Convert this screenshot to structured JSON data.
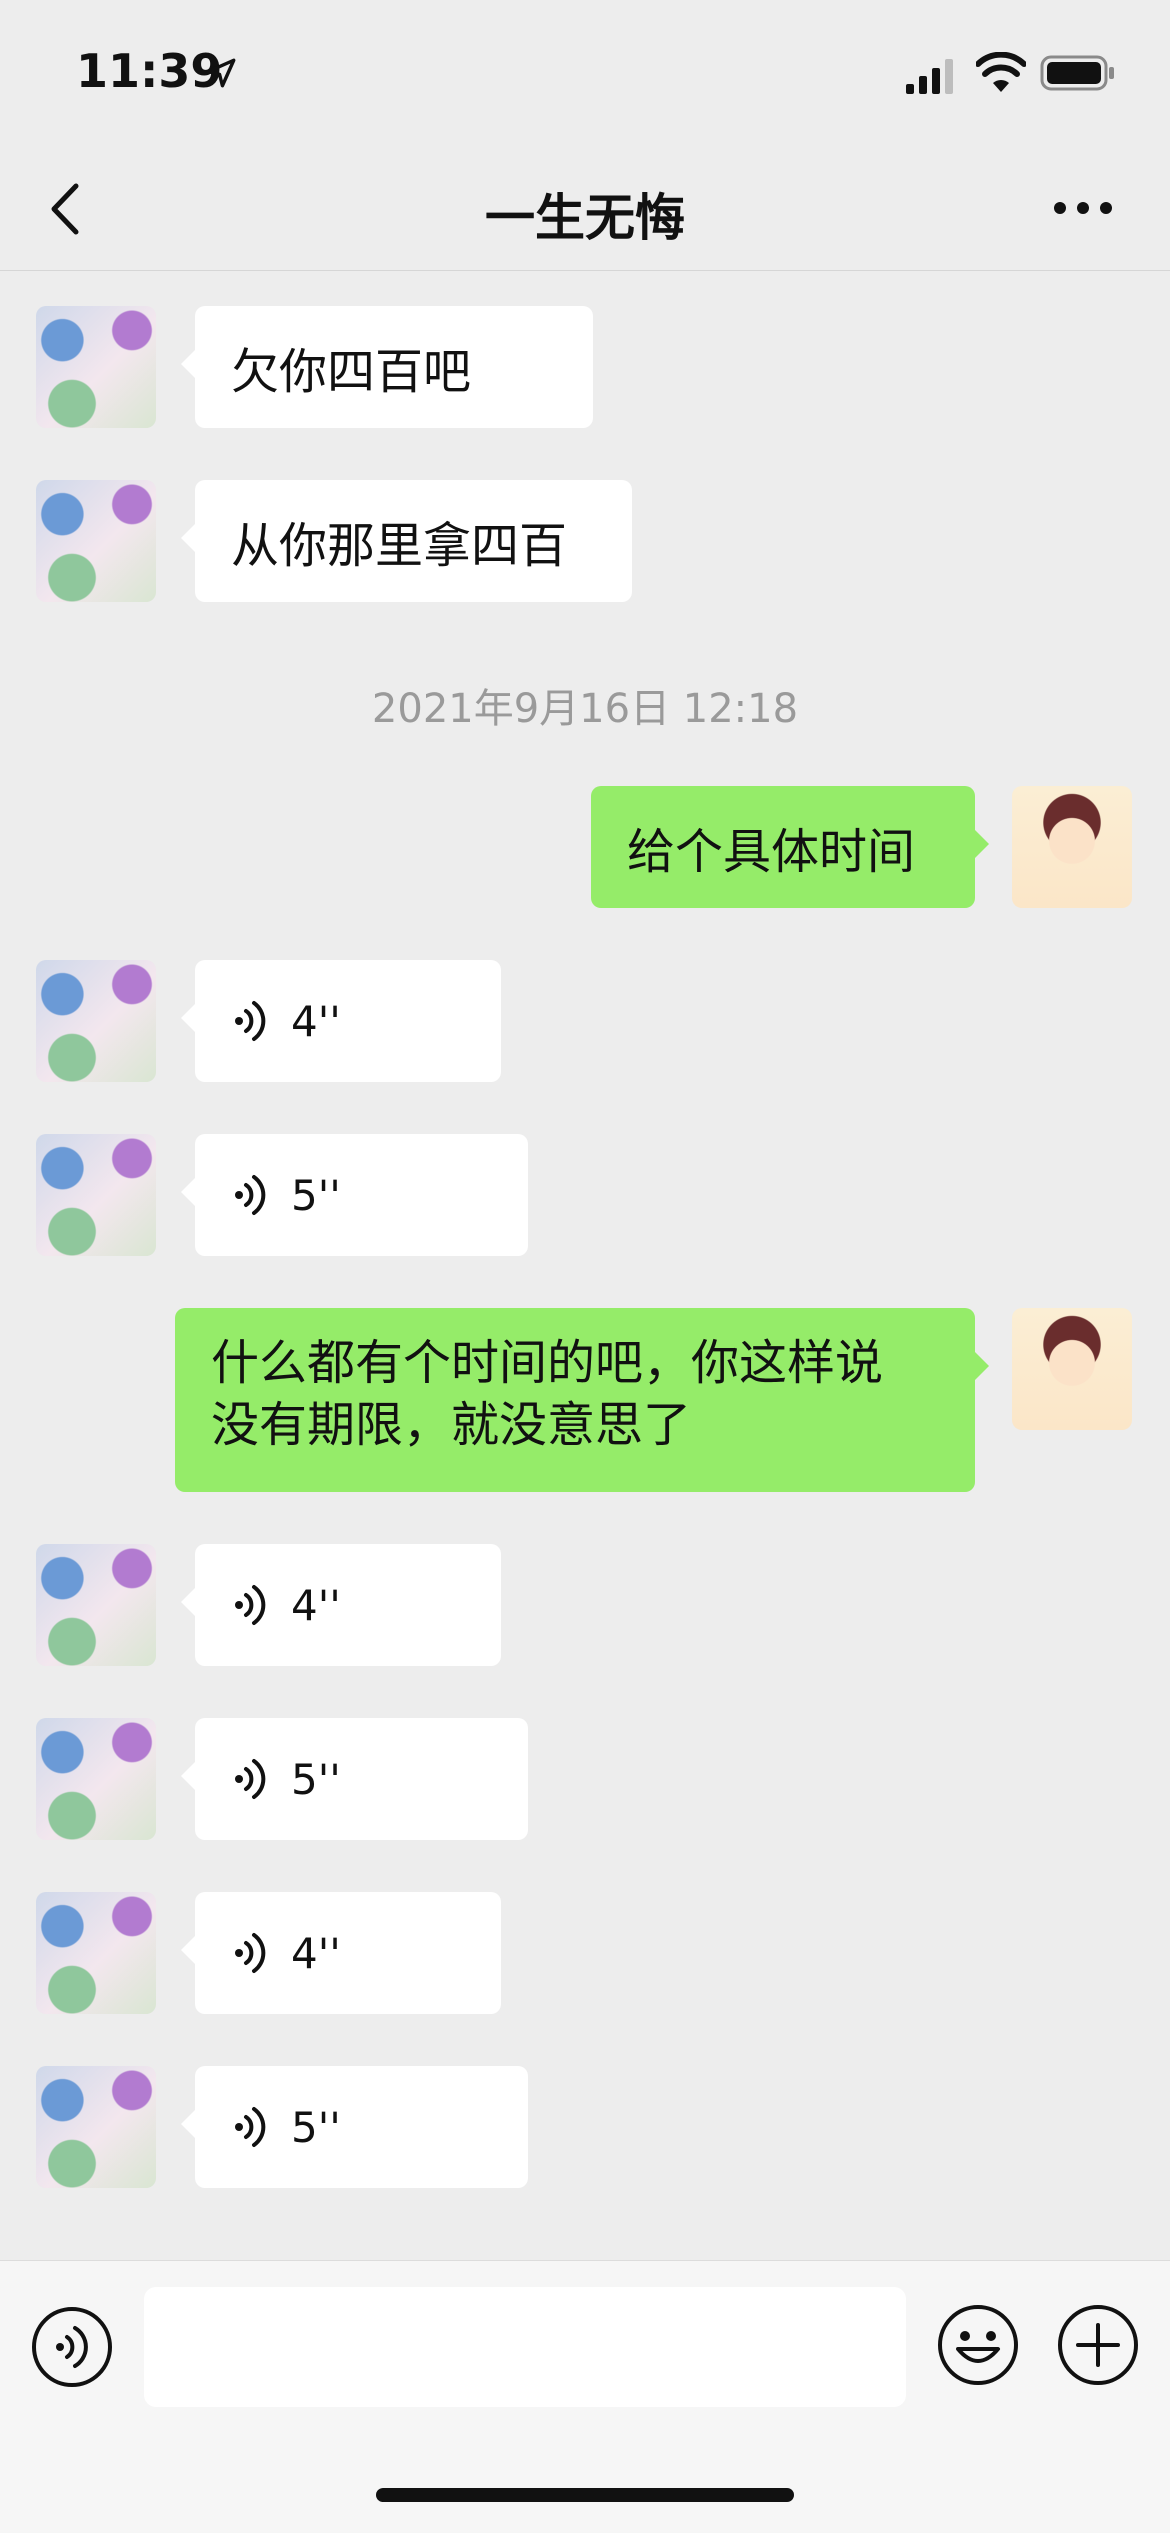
{
  "status": {
    "time": "11:39"
  },
  "nav": {
    "title": "一生无悔"
  },
  "messages": [
    {
      "side": "left",
      "type": "text",
      "text": "欠你四百吧"
    },
    {
      "side": "left",
      "type": "text",
      "text": "从你那里拿四百"
    },
    {
      "type": "timestamp",
      "text": "2021年9月16日 12:18"
    },
    {
      "side": "right",
      "type": "text",
      "text": "给个具体时间"
    },
    {
      "side": "left",
      "type": "voice",
      "duration": "4''"
    },
    {
      "side": "left",
      "type": "voice",
      "duration": "5''"
    },
    {
      "side": "right",
      "type": "text",
      "line1": "什么都有个时间的吧，你这样说",
      "line2": "没有期限，就没意思了"
    },
    {
      "side": "left",
      "type": "voice",
      "duration": "4''"
    },
    {
      "side": "left",
      "type": "voice",
      "duration": "5''"
    },
    {
      "side": "left",
      "type": "voice",
      "duration": "4''"
    },
    {
      "side": "left",
      "type": "voice",
      "duration": "5''"
    }
  ],
  "input": {
    "value": "",
    "placeholder": ""
  },
  "icons": {
    "back": "chevron-left-icon",
    "more": "more-icon",
    "voice": "voice-wave-icon",
    "emoji": "emoji-icon",
    "plus": "plus-icon"
  },
  "colors": {
    "background": "#ededed",
    "my_bubble": "#95ec69",
    "friend_bubble": "#ffffff"
  }
}
